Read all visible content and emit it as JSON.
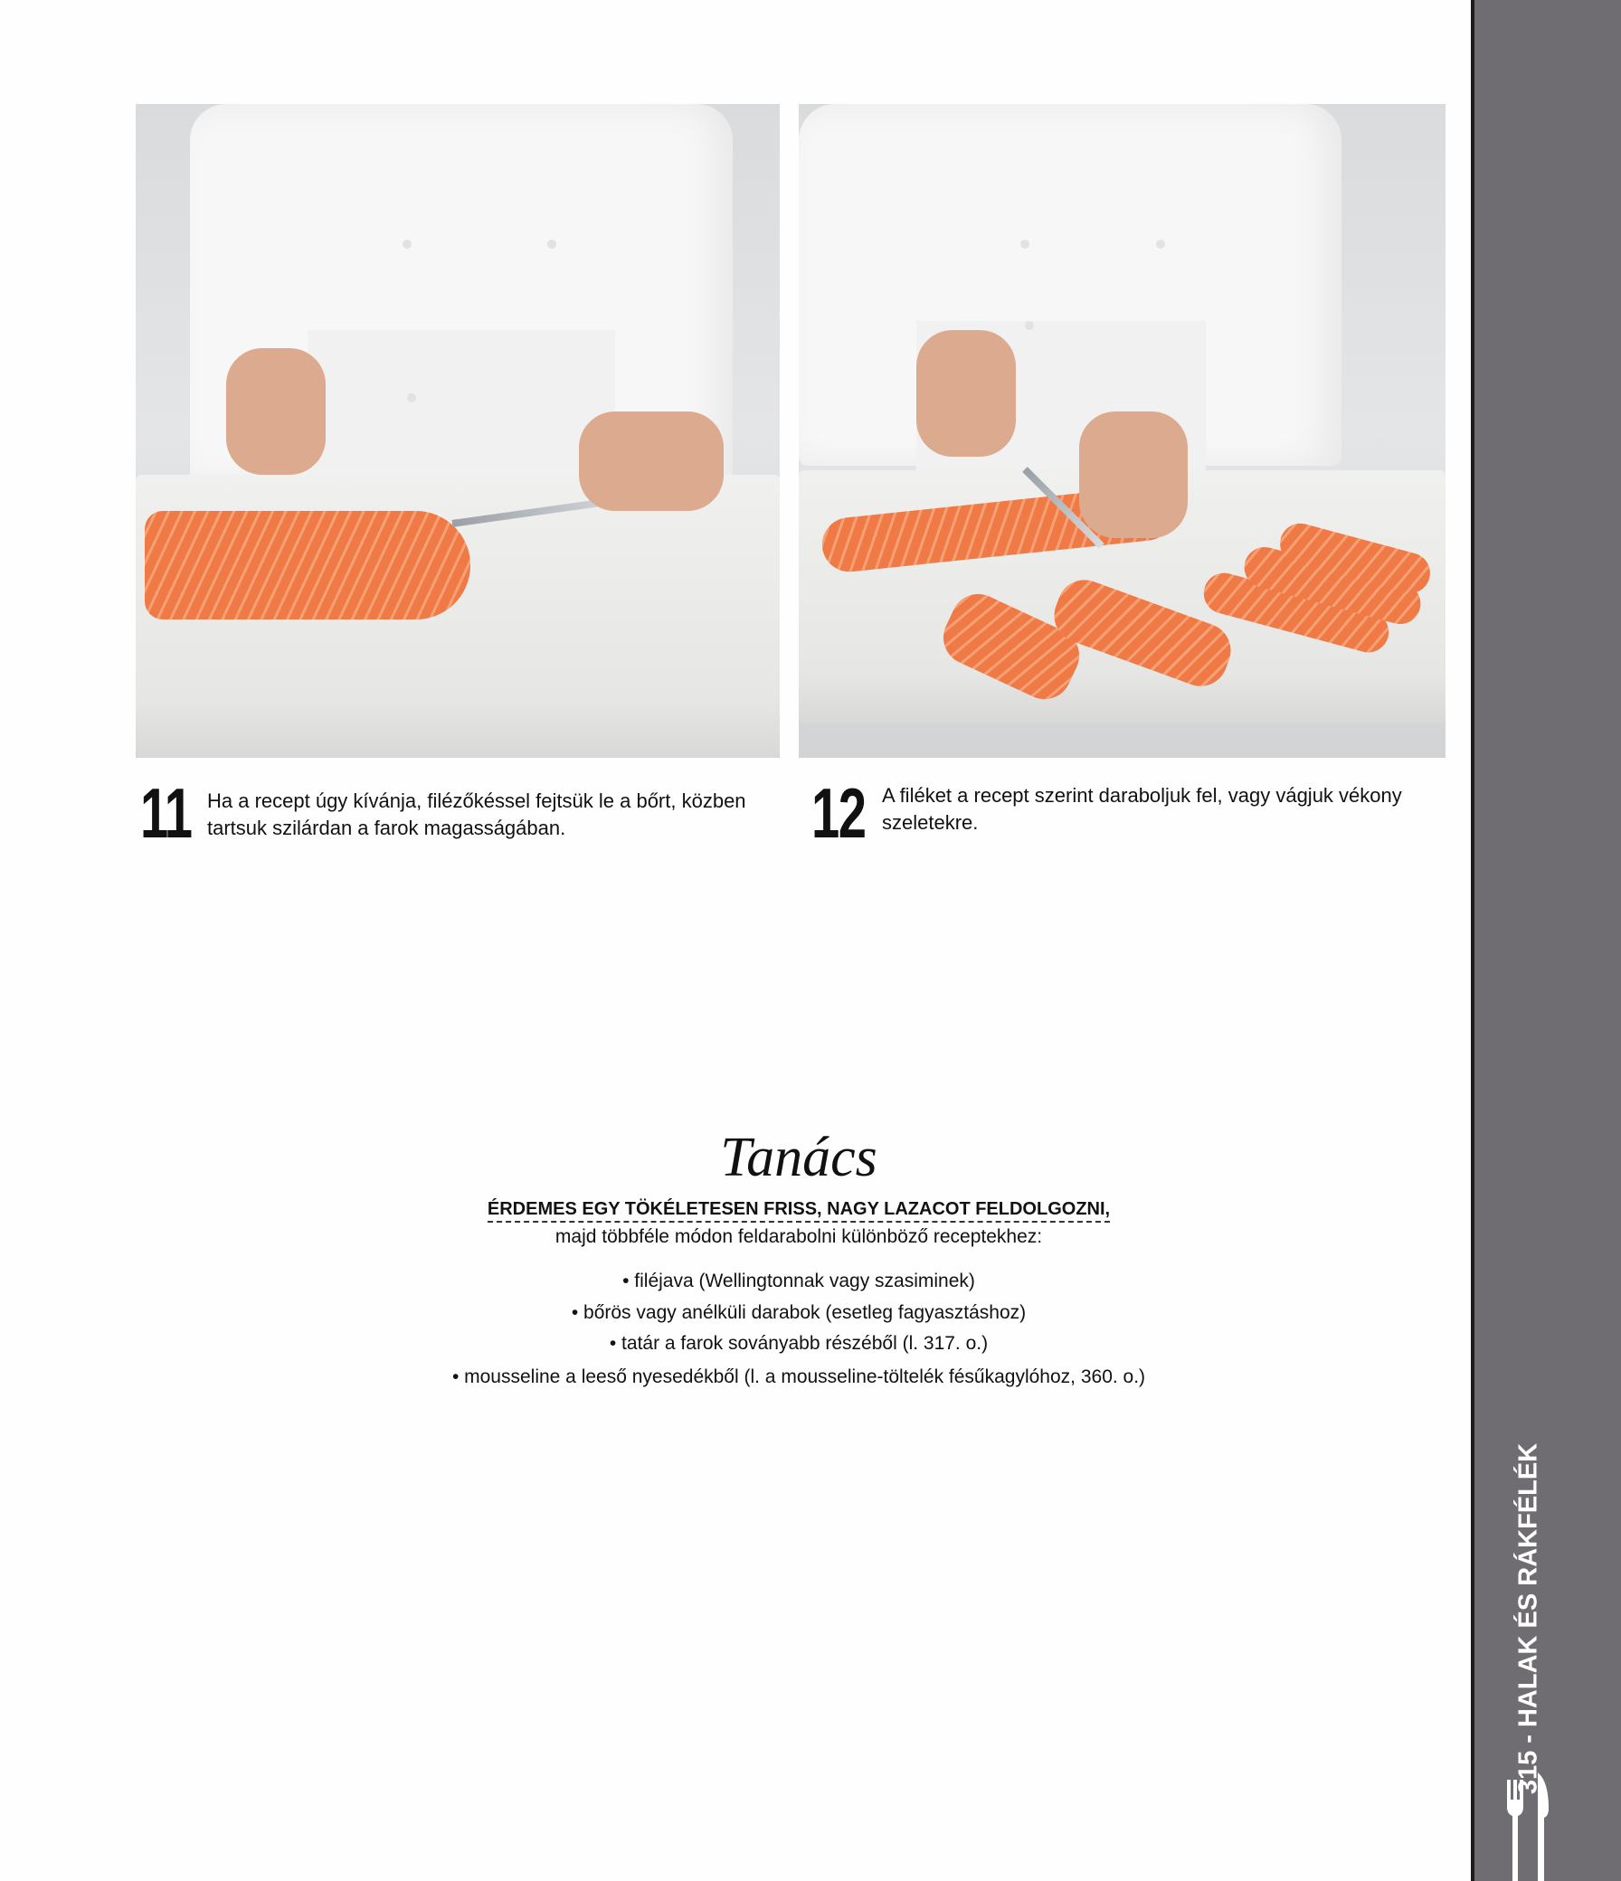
{
  "steps": [
    {
      "number": "11",
      "text_line1": "Ha a recept úgy kívánja, filézőkéssel fejtsük le a bőrt, közben",
      "text_line2": "tartsuk szilárdan a farok magasságában."
    },
    {
      "number": "12",
      "text_line1": "A filéket a recept szerint daraboljuk fel, vagy vágjuk vékony",
      "text_line2": "szeletekre."
    }
  ],
  "tip": {
    "title": "Tanács",
    "lead": "ÉRDEMES EGY TÖKÉLETESEN FRISS, NAGY LAZACOT FELDOLGOZNI,",
    "sub": "majd többféle módon feldarabolni különböző receptekhez:",
    "items": [
      "• filéjava (Wellingtonnak vagy szasiminek)",
      "• bőrös vagy anélküli darabok (esetleg fagyasztáshoz)",
      "• tatár a farok soványabb részéből (l. 317. o.)",
      "• mousseline a leeső nyesedékből (l. a mousseline-töltelék fésűkagylóhoz, 360. o.)"
    ]
  },
  "sidebar": {
    "label": "315 - HALAK ÉS RÁKFÉLÉK",
    "icon": "fork-knife-icon",
    "color": "#6f6c72"
  }
}
